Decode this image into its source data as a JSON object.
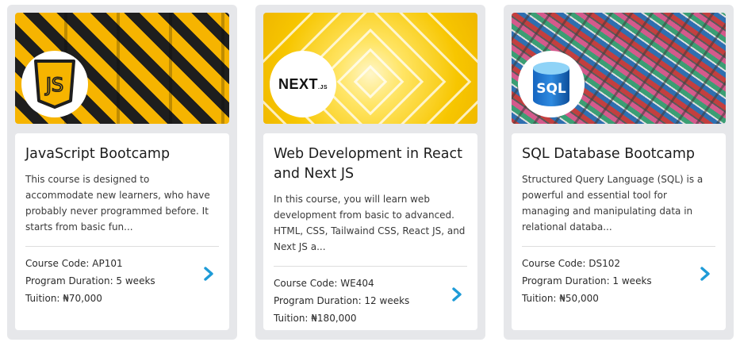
{
  "courses": [
    {
      "title": "JavaScript Bootcamp",
      "description": "This course is designed to accommodate new learners, who have probably never programmed before. It starts from basic fun...",
      "code": "Course Code: AP101",
      "duration": "Program Duration: 5 weeks",
      "tuition": "Tuition: ₦70,000",
      "logo_text": "JS",
      "logo_icon": "javascript-shield-icon",
      "banner_colors": [
        "#f6b400",
        "#1e1e1e"
      ]
    },
    {
      "title": "Web Development in React and Next JS",
      "description": "In this course, you will learn web development from basic to advanced. HTML, CSS, Tailwaind CSS, React JS, and Next JS a...",
      "code": "Course Code: WE404",
      "duration": "Program Duration: 12 weeks",
      "tuition": "Tuition: ₦180,000",
      "logo_text": "NEXT",
      "logo_subtext": ".JS",
      "logo_icon": "nextjs-logo-icon",
      "banner_colors": [
        "#f7c600",
        "#ffffff"
      ]
    },
    {
      "title": "SQL Database Bootcamp",
      "description": "Structured Query Language (SQL) is a powerful and essential tool for managing and manipulating data in relational databa...",
      "code": "Course Code: DS102",
      "duration": "Program Duration: 1 weeks",
      "tuition": "Tuition: ₦50,000",
      "logo_text": "SQL",
      "logo_icon": "sql-database-icon",
      "banner_colors": [
        "#c33f3f",
        "#2f6fb0",
        "#3b9e74"
      ]
    }
  ],
  "theme": {
    "arrow_color": "#1e9bd7",
    "card_bg": "#e6e7ea"
  }
}
